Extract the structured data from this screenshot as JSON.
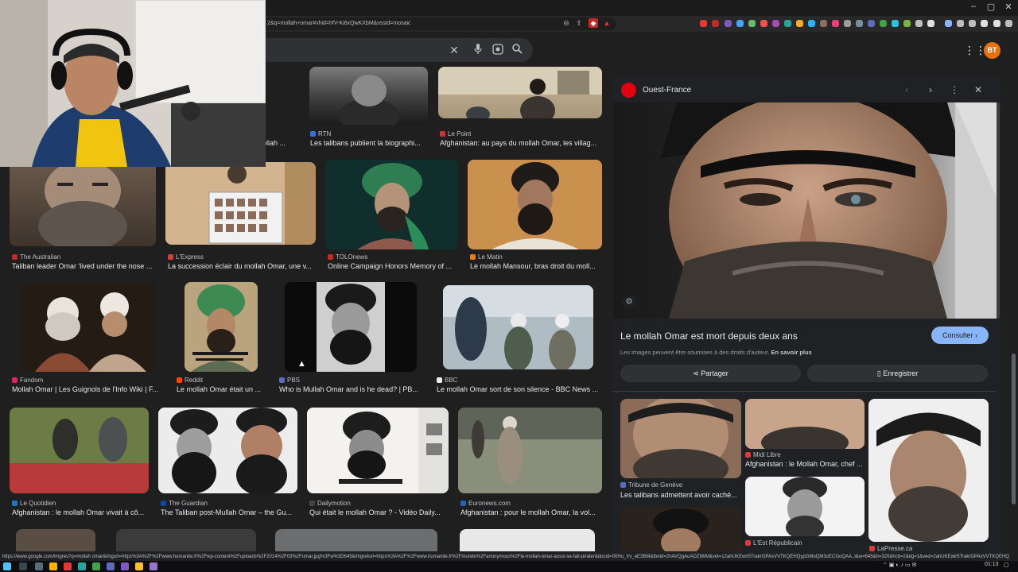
{
  "browser": {
    "url": "2&q=mollah+omar#vhid=hfV-Ki6xQwKXbM&vssid=mosaic",
    "window_controls": [
      "–",
      "▢",
      "✕"
    ]
  },
  "search": {
    "clear_icon": "close-icon",
    "mic_icon": "microphone-icon",
    "lens_icon": "lens-icon",
    "search_icon": "search-icon"
  },
  "header": {
    "avatar_initials": "BT"
  },
  "results": [
    {
      "source": "RTN",
      "title": "Les talibans publient la biographi...",
      "fav_color": "#3b6fd4"
    },
    {
      "source": "Le Point",
      "title": "Afghanistan: au pays du mollah Omar, les villag...",
      "fav_color": "#d32f2f"
    },
    {
      "source": "",
      "title": "ollah ...",
      "fav_color": "#888888"
    },
    {
      "source": "The Australian",
      "title": "Taliban leader Omar 'lived under the nose ...",
      "fav_color": "#c62828"
    },
    {
      "source": "L'Express",
      "title": "La succession éclair du mollah Omar, une v...",
      "fav_color": "#e53935"
    },
    {
      "source": "TOLOnews",
      "title": "Online Campaign Honors Memory of ...",
      "fav_color": "#c62828"
    },
    {
      "source": "Le Matin",
      "title": "Le mollah Mansour, bras droit du moll...",
      "fav_color": "#f57c00"
    },
    {
      "source": "Fandom",
      "title": "Mollah Omar | Les Guignols de l'Info Wiki | F...",
      "fav_color": "#e91e63"
    },
    {
      "source": "Reddit",
      "title": "Le mollah Omar était un ...",
      "fav_color": "#ff4500"
    },
    {
      "source": "PBS",
      "title": "Who is Mullah Omar and is he dead? | PB...",
      "fav_color": "#5c6bc0"
    },
    {
      "source": "BBC",
      "title": "Le mollah Omar sort de son silence - BBC News ...",
      "fav_color": "#eeeeee"
    },
    {
      "source": "Le Quotidien",
      "title": "Afghanistan : le mollah Omar vivait à cô...",
      "fav_color": "#1976d2"
    },
    {
      "source": "The Guardian",
      "title": "The Taliban post-Mullah Omar – the Gu...",
      "fav_color": "#0d47a1"
    },
    {
      "source": "Dailymotion",
      "title": "Qui était le mollah Omar ? - Vidéo Daily...",
      "fav_color": "#444444"
    },
    {
      "source": "Euronews.com",
      "title": "Afghanistan : pour le mollah Omar, la vol...",
      "fav_color": "#1565c0"
    }
  ],
  "panel": {
    "site": "Ouest-France",
    "title": "Le mollah Omar est mort depuis deux ans",
    "rights_text": "Les images peuvent être soumises à des droits d'auteur.",
    "rights_link": "En savoir plus",
    "consult_label": "Consulter ›",
    "share_label": "Partager",
    "save_label": "Enregistrer",
    "related": [
      {
        "source": "Tribune de Genève",
        "title": "Les talibans admettent avoir caché...",
        "fav_color": "#5c6bc0"
      },
      {
        "source": "Midi Libre",
        "title": "Afghanistan : le Mollah Omar, chef ...",
        "fav_color": "#e53935"
      },
      {
        "source": "L'Est Républicain",
        "title": "",
        "fav_color": "#e53935"
      },
      {
        "source": "LaPresse.ca",
        "title": "",
        "fav_color": "#e53935"
      }
    ]
  },
  "status_url": "https://www.google.com/imgres?q=mollah omar&imgurl=https%3A%2F%2Fwww.humanite.fr%2Fwp-content%2Fuploads%2F2014%2F03%2Fomar.jpg%3Fw%3D645&imgrefurl=https%3A%2F%2Fwww.humanite.fr%2Fmonde%2Fanonymous%2Fle-mollah-omar-aussi-se-fait-pirater&docid=00Hu_Vv_eE3BM&tbnid=2nAVQgAuADZtWM&vet=12ahUKEwir5TrakrGPAxVVTKQEHQypGMoQM3oECGoQAA..i&w=645&h=320&hcb=2&itg=1&ved=2ahUKEwir5TrakrGPAxVVTKQEHQ",
  "taskbar": {
    "time": "01:13"
  }
}
